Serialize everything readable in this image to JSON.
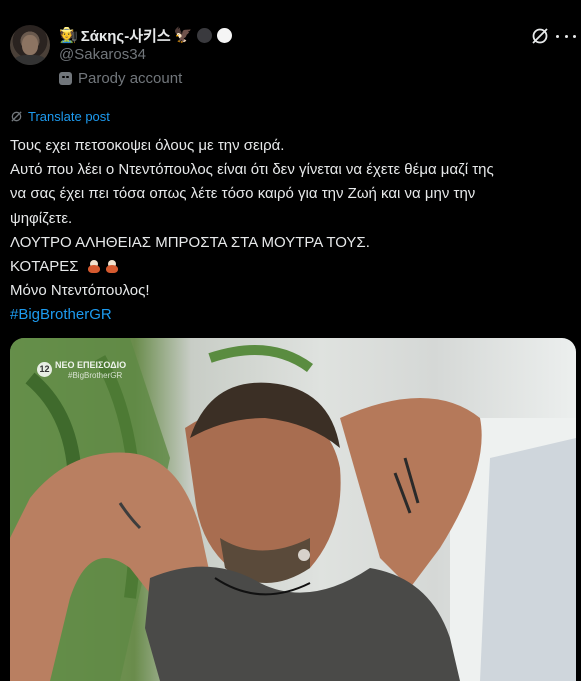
{
  "author": {
    "name_emoji": "🧑‍🌾",
    "display_name": "Σάκης-사키스",
    "extra_emoji": "🦅",
    "dot_colors": [
      "#3a3a3e",
      "#f5f5f5"
    ],
    "handle": "@Sakaros34",
    "label": "Parody account"
  },
  "translate_label": "Translate post",
  "post_lines": [
    "Τους εχει πετσοκοψει όλους με την σειρά.",
    "Αυτό που λέει ο Ντεντόπουλος είναι ότι δεν γίνεται να έχετε θέμα μαζί της",
    "να σας έχει πει τόσα οπως λέτε τόσο καιρό για την Ζωή και να μην την",
    "ψηφίζετε.",
    "ΛΟΥΤΡΟ ΑΛΗΘΕΙΑΣ ΜΠΡΟΣΤΑ ΣΤΑ ΜΟΥΤΡΑ ΤΟΥΣ.",
    "ΚΟΤΑΡΕΣ",
    "Μόνο Ντεντόπουλος!"
  ],
  "hashtag": "#BigBrotherGR",
  "media": {
    "watermark_number": "12",
    "watermark_title": "ΝΕΟ ΕΠΕΙΣΟΔΙΟ",
    "watermark_tag": "#BigBrotherGR"
  },
  "colors": {
    "link": "#1d9bf0",
    "muted": "#71767b",
    "text": "#e7e9ea",
    "background": "#000000"
  }
}
